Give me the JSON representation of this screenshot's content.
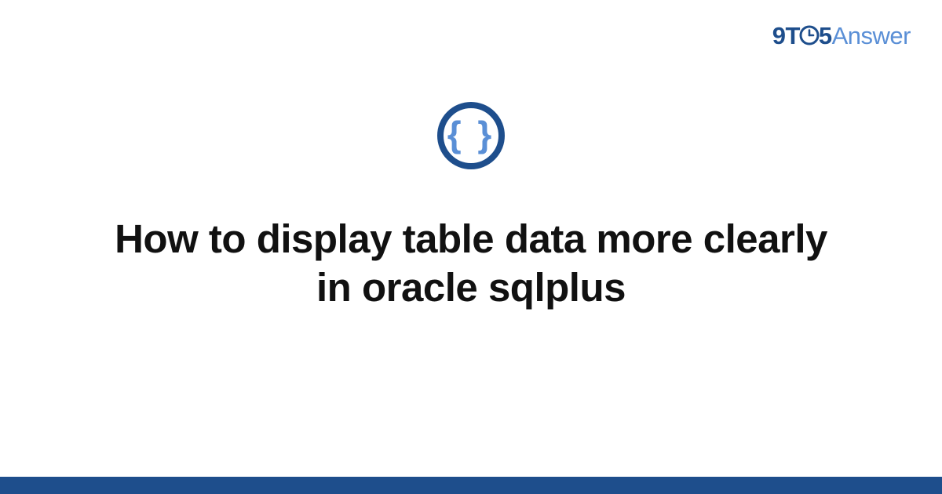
{
  "brand": {
    "part_9": "9",
    "part_T": "T",
    "part_5": "5",
    "part_answer": "Answer",
    "clock_icon": "clock-icon"
  },
  "hero": {
    "badge_glyph": "{ }",
    "title": "How to display table data more clearly in oracle sqlplus"
  },
  "colors": {
    "brand_dark": "#1e4e8c",
    "brand_light": "#5a8fd6",
    "text": "#111111",
    "background": "#ffffff"
  }
}
